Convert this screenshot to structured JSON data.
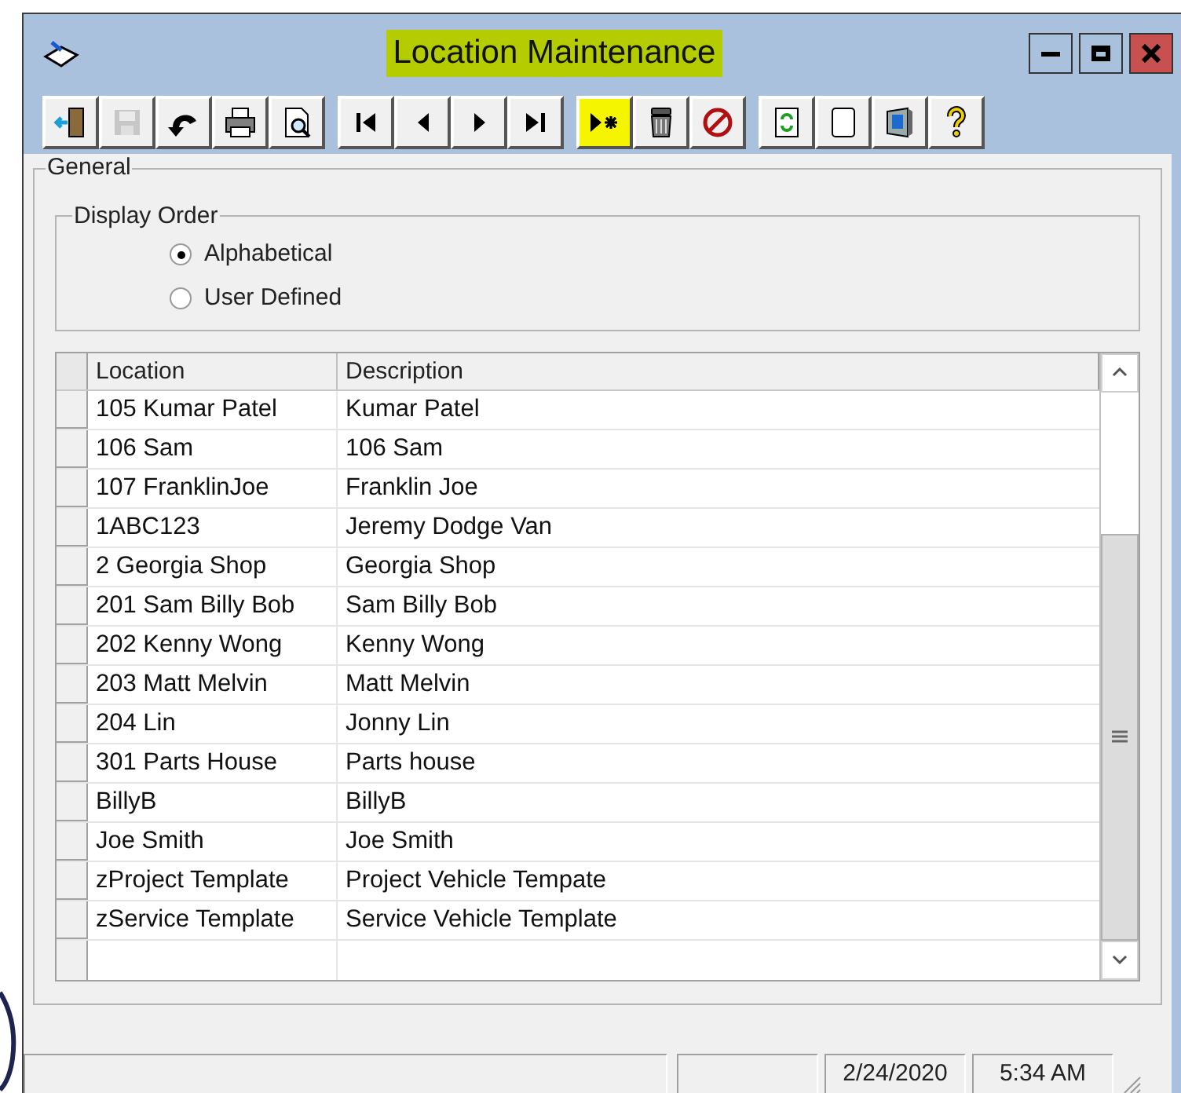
{
  "window": {
    "title": "Location Maintenance",
    "title_highlighted": true
  },
  "toolbar": [
    {
      "buttons": [
        {
          "kind": "exit",
          "disabled": false,
          "highlighted": false
        },
        {
          "kind": "save",
          "disabled": true,
          "highlighted": false
        },
        {
          "kind": "undo",
          "disabled": false,
          "highlighted": false
        },
        {
          "kind": "print",
          "disabled": false,
          "highlighted": false
        },
        {
          "kind": "preview",
          "disabled": false,
          "highlighted": false
        }
      ]
    },
    {
      "buttons": [
        {
          "kind": "first",
          "disabled": false,
          "highlighted": false
        },
        {
          "kind": "prev",
          "disabled": false,
          "highlighted": false
        },
        {
          "kind": "next",
          "disabled": false,
          "highlighted": false
        },
        {
          "kind": "last",
          "disabled": false,
          "highlighted": false
        }
      ]
    },
    {
      "buttons": [
        {
          "kind": "new",
          "disabled": false,
          "highlighted": true
        },
        {
          "kind": "delete",
          "disabled": false,
          "highlighted": false
        },
        {
          "kind": "cancel",
          "disabled": false,
          "highlighted": false
        }
      ]
    },
    {
      "buttons": [
        {
          "kind": "refresh",
          "disabled": false,
          "highlighted": false
        },
        {
          "kind": "notes",
          "disabled": false,
          "highlighted": false
        },
        {
          "kind": "monitor",
          "disabled": false,
          "highlighted": false
        },
        {
          "kind": "help",
          "disabled": false,
          "highlighted": false
        }
      ]
    }
  ],
  "general": {
    "label": "General",
    "display_order": {
      "label": "Display Order",
      "options": [
        {
          "label": "Alphabetical",
          "selected": true
        },
        {
          "label": "User Defined",
          "selected": false
        }
      ]
    }
  },
  "grid": {
    "columns": [
      "Location",
      "Description"
    ],
    "rows": [
      {
        "location": "105 Kumar Patel",
        "description": "Kumar Patel"
      },
      {
        "location": "106 Sam",
        "description": "106 Sam"
      },
      {
        "location": "107 FranklinJoe",
        "description": "Franklin Joe"
      },
      {
        "location": "1ABC123",
        "description": "Jeremy Dodge Van"
      },
      {
        "location": "2 Georgia Shop",
        "description": "Georgia Shop"
      },
      {
        "location": "201 Sam Billy Bob",
        "description": "Sam Billy Bob"
      },
      {
        "location": "202 Kenny Wong",
        "description": "Kenny Wong"
      },
      {
        "location": "203 Matt Melvin",
        "description": "Matt Melvin"
      },
      {
        "location": "204 Lin",
        "description": "Jonny Lin"
      },
      {
        "location": "301 Parts House",
        "description": "Parts house"
      },
      {
        "location": "BillyB",
        "description": "BillyB"
      },
      {
        "location": "Joe Smith",
        "description": "Joe Smith"
      },
      {
        "location": "zProject Template",
        "description": "Project Vehicle Tempate"
      },
      {
        "location": "zService Template",
        "description": "Service Vehicle Template"
      }
    ]
  },
  "status_bar": {
    "date": "2/24/2020",
    "time": "5:34 AM"
  }
}
